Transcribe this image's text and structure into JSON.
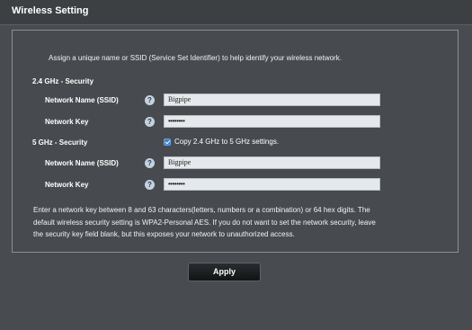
{
  "header": {
    "title": "Wireless Setting"
  },
  "intro_text": "Assign a unique name or SSID (Service Set Identifier) to help identify your wireless network.",
  "band_24": {
    "section_label": "2.4 GHz - Security",
    "ssid_label": "Network Name (SSID)",
    "ssid_value": "Bigpipe",
    "key_label": "Network Key",
    "key_value": "••••••••"
  },
  "band_5": {
    "section_label": "5 GHz - Security",
    "copy_checkbox_label": "Copy 2.4 GHz to 5 GHz settings.",
    "copy_checked": true,
    "ssid_label": "Network Name (SSID)",
    "ssid_value": "Bigpipe",
    "key_label": "Network Key",
    "key_value": "••••••••"
  },
  "help_glyph": "?",
  "icons": {
    "help": "help-icon",
    "checkbox": "checkbox-checked"
  },
  "note_lines": [
    "Enter a network key between 8 and 63 characters(letters, numbers or a combination) or 64 hex digits. The",
    "default wireless security setting is WPA2-Personal AES. If you do not want to set the network security, leave",
    "the security key field blank, but this exposes your network to unauthorized access."
  ],
  "apply_label": "Apply",
  "colors": {
    "background": "#484c50",
    "checkbox_accent": "#3f7fc9",
    "input_bg": "#e6e9ec"
  }
}
